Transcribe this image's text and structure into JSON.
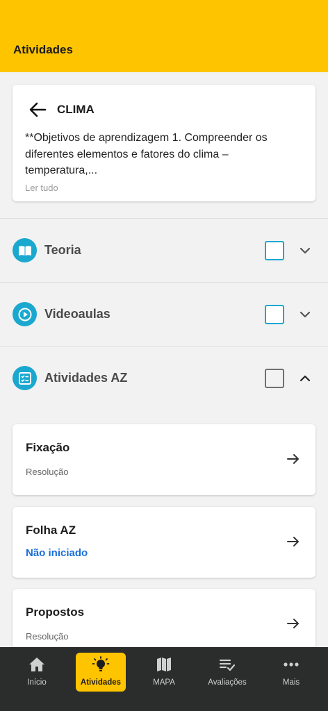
{
  "header": {
    "title": "Atividades"
  },
  "intro": {
    "topic": "CLIMA",
    "description": "**Objetivos de aprendizagem  1. Compreender os diferentes elementos e fatores do clima – temperatura,...",
    "read_more": "Ler tudo"
  },
  "sections": [
    {
      "label": "Teoria",
      "icon": "book-icon",
      "checked": false,
      "expanded": false
    },
    {
      "label": "Videoaulas",
      "icon": "play-circle-icon",
      "checked": false,
      "expanded": false
    },
    {
      "label": "Atividades AZ",
      "icon": "checklist-icon",
      "checked": false,
      "expanded": true
    }
  ],
  "activities": [
    {
      "title": "Fixação",
      "status": "Resolução"
    },
    {
      "title": "Folha AZ",
      "status": "Não iniciado"
    },
    {
      "title": "Propostos",
      "status": "Resolução"
    }
  ],
  "nav": {
    "items": [
      {
        "label": "Início",
        "icon": "home-icon"
      },
      {
        "label": "Atividades",
        "icon": "lightbulb-icon",
        "active": true
      },
      {
        "label": "MAPA",
        "icon": "map-icon"
      },
      {
        "label": "Avaliações",
        "icon": "list-check-icon"
      },
      {
        "label": "Mais",
        "icon": "more-icon"
      }
    ]
  },
  "colors": {
    "brand_yellow": "#ffc400",
    "accent_cyan": "#1ba8cf",
    "link_blue": "#1a6fd8",
    "nav_bg": "#2a2d2c"
  }
}
